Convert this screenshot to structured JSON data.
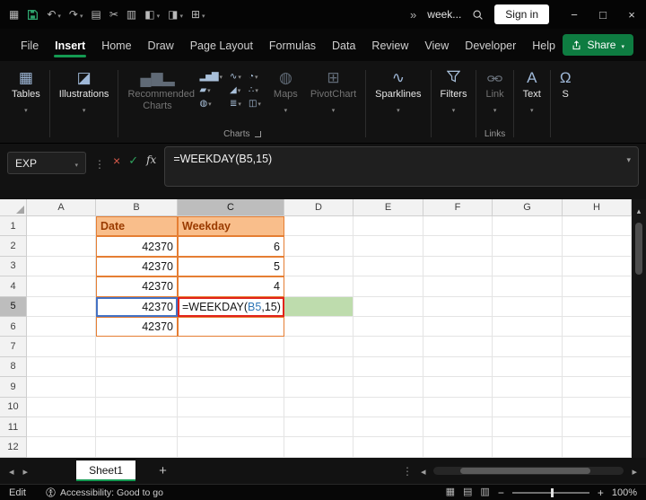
{
  "titlebar": {
    "icons": [
      {
        "name": "apps-grid-icon",
        "glyph": "▦"
      },
      {
        "name": "undo-icon",
        "glyph": "↶"
      },
      {
        "name": "redo-icon",
        "glyph": "↷"
      },
      {
        "name": "copy-icon",
        "glyph": "▤"
      },
      {
        "name": "cut-icon",
        "glyph": "✂"
      },
      {
        "name": "paste-icon",
        "glyph": "▥"
      },
      {
        "name": "format-painter-icon",
        "glyph": "◧"
      },
      {
        "name": "fill-color-icon",
        "glyph": "◨"
      },
      {
        "name": "borders-icon",
        "glyph": "⊞"
      }
    ],
    "more_commands_glyph": "»",
    "document_title": "week...",
    "sign_in_label": "Sign in",
    "window_controls": {
      "minimize": "−",
      "maximize": "□",
      "close": "×"
    }
  },
  "menu": {
    "tabs": [
      {
        "label": "File"
      },
      {
        "label": "Insert"
      },
      {
        "label": "Home"
      },
      {
        "label": "Draw"
      },
      {
        "label": "Page Layout"
      },
      {
        "label": "Formulas"
      },
      {
        "label": "Data"
      },
      {
        "label": "Review"
      },
      {
        "label": "View"
      },
      {
        "label": "Developer"
      },
      {
        "label": "Help"
      }
    ],
    "active_tab": "Insert",
    "share_label": "Share"
  },
  "ribbon": {
    "tables": {
      "label": "Tables",
      "icon_glyph": "▦"
    },
    "illustrations": {
      "label": "Illustrations",
      "icon_glyph": "◪"
    },
    "recommended_charts": {
      "label": "Recommended Charts",
      "icon_glyph": "▄▆▂"
    },
    "chart_icons": [
      {
        "name": "column-chart-icon",
        "glyph": "▂▅▇"
      },
      {
        "name": "line-chart-icon",
        "glyph": "∿"
      },
      {
        "name": "pie-chart-icon",
        "glyph": "◔"
      },
      {
        "name": "bar-chart-icon",
        "glyph": "▰"
      },
      {
        "name": "area-chart-icon",
        "glyph": "◢"
      },
      {
        "name": "scatter-chart-icon",
        "glyph": "∴"
      },
      {
        "name": "map-chart-icon",
        "glyph": "◍"
      },
      {
        "name": "stock-chart-icon",
        "glyph": "≣"
      },
      {
        "name": "combo-chart-icon",
        "glyph": "◫"
      }
    ],
    "charts_group_label": "Charts",
    "maps": {
      "label": "Maps",
      "icon_glyph": "◍"
    },
    "pivotchart": {
      "label": "PivotChart",
      "icon_glyph": "⊞"
    },
    "sparklines": {
      "label": "Sparklines",
      "icon_glyph": "∿"
    },
    "filters": {
      "label": "Filters"
    },
    "link": {
      "label": "Link"
    },
    "links_group_label": "Links",
    "text": {
      "label": "Text",
      "icon_glyph": "A"
    },
    "symbols": {
      "label": "S",
      "icon_glyph": "Ω"
    }
  },
  "formula_bar": {
    "name_box_value": "EXP",
    "cancel_glyph": "×",
    "enter_glyph": "✓",
    "fx_label": "fx",
    "formula": "=WEEKDAY(B5,15)"
  },
  "grid": {
    "col_headers": [
      "A",
      "B",
      "C",
      "D",
      "E",
      "F",
      "G",
      "H"
    ],
    "row_headers": [
      "1",
      "2",
      "3",
      "4",
      "5",
      "6",
      "7",
      "8",
      "9",
      "10",
      "11",
      "12"
    ],
    "selected_col": "C",
    "selected_row": "5",
    "cells": {
      "B1": {
        "text": "Date",
        "style": "hdr"
      },
      "C1": {
        "text": "Weekday",
        "style": "hdr"
      },
      "B2": {
        "text": "42370",
        "style": "num tbl"
      },
      "C2": {
        "text": "6",
        "style": "num tbl"
      },
      "B3": {
        "text": "42370",
        "style": "num tbl"
      },
      "C3": {
        "text": "5",
        "style": "num tbl"
      },
      "B4": {
        "text": "42370",
        "style": "num tbl"
      },
      "C4": {
        "text": "4",
        "style": "num tbl"
      },
      "B5": {
        "text": "42370",
        "style": "num tbl ref"
      },
      "B6": {
        "text": "42370",
        "style": "num tbl"
      },
      "C6": {
        "text": "",
        "style": "tbl"
      },
      "D5": {
        "text": "",
        "style": "fill"
      }
    },
    "editing": {
      "cell": "C5",
      "pre": "=WEEKDAY(",
      "ref": "B5",
      "post": ",15)"
    }
  },
  "sheet_tabs": {
    "active_tab": "Sheet1",
    "add_glyph": "+"
  },
  "status_bar": {
    "mode": "Edit",
    "accessibility": "Accessibility: Good to go",
    "view_icons": [
      {
        "name": "normal-view-icon",
        "glyph": "▦"
      },
      {
        "name": "page-layout-view-icon",
        "glyph": "▤"
      },
      {
        "name": "page-break-view-icon",
        "glyph": "▥"
      }
    ],
    "zoom_out_glyph": "−",
    "zoom_in_glyph": "+",
    "zoom_level": "100%"
  },
  "colors": {
    "accent_green": "#149a52",
    "share_green": "#0e7c41",
    "table_border_orange": "#e57e33",
    "table_fill_orange": "#f9be8b",
    "table_text_brown": "#9a3b00",
    "edit_red": "#e2231a",
    "ref_blue": "#4472c4",
    "fill_preview_green": "#bedcad"
  }
}
